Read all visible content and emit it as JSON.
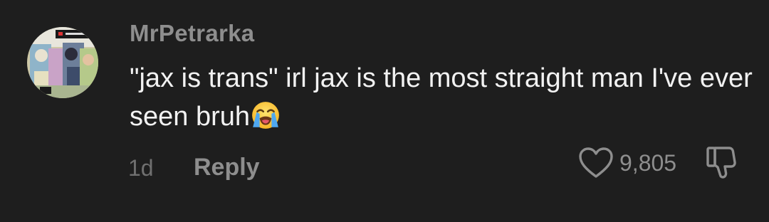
{
  "comment": {
    "username": "MrPetrarka",
    "text": "\"jax is trans\" irl jax is the most straight man I've ever seen bruh",
    "emoji": "loudly-crying-face",
    "timestamp": "1d",
    "reply_label": "Reply",
    "like_count": "9,805",
    "like_icon": "heart-outline-icon",
    "dislike_icon": "thumbs-down-outline-icon"
  },
  "colors": {
    "background": "#1e1e1e",
    "text": "#f2f2f2",
    "muted": "#8e8e8e"
  }
}
